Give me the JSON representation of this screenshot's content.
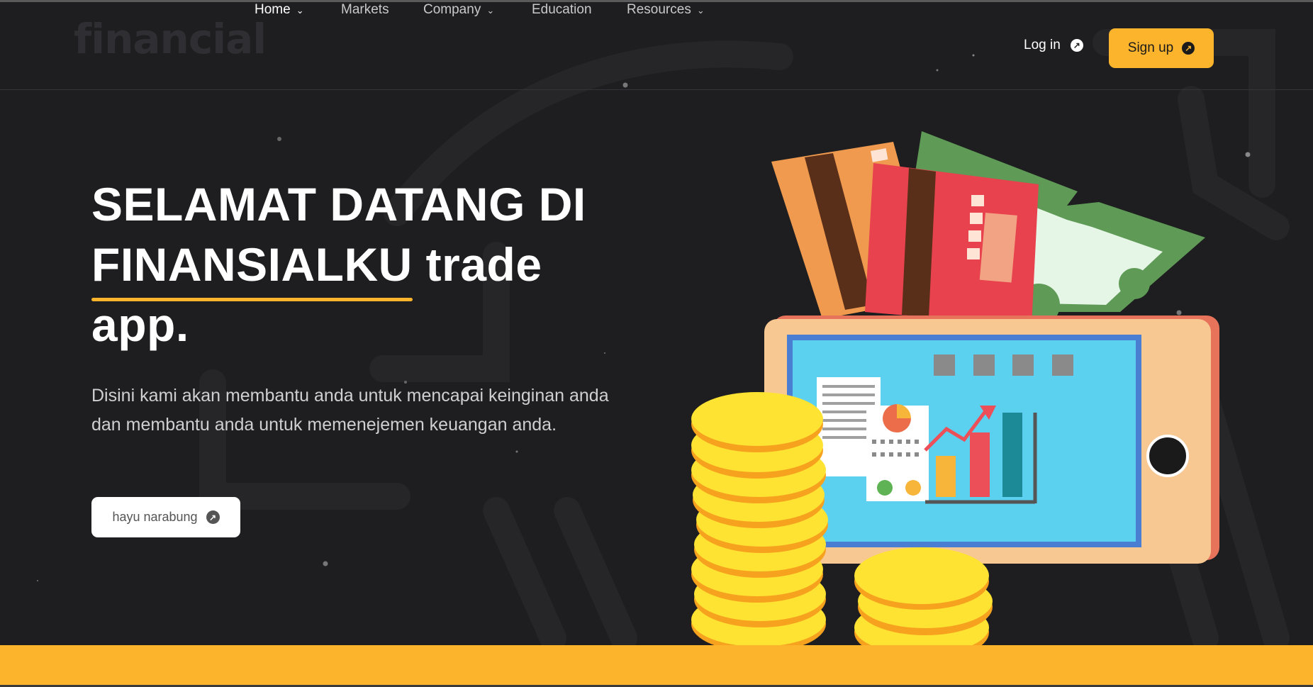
{
  "logo": "financial",
  "nav": {
    "items": [
      {
        "label": "Home",
        "dropdown": true,
        "active": true
      },
      {
        "label": "Markets",
        "dropdown": false,
        "active": false
      },
      {
        "label": "Company",
        "dropdown": true,
        "active": false
      },
      {
        "label": "Education",
        "dropdown": false,
        "active": false
      },
      {
        "label": "Resources",
        "dropdown": true,
        "active": false
      }
    ],
    "login_label": "Log in",
    "signup_label": "Sign up"
  },
  "hero": {
    "title_line1": "SELAMAT DATANG DI",
    "title_highlight": "FINANSIALKU",
    "title_after_highlight": " trade",
    "title_line3": "app.",
    "description": "Disini kami akan membantu anda untuk mencapai keinginan anda dan membantu anda untuk memenejemen keuangan anda.",
    "cta_label": "hayu narabung"
  },
  "colors": {
    "accent": "#fbb42b",
    "background": "#1e1e20"
  },
  "icons": {
    "chevron": "chevron-down-icon",
    "arrow": "arrow-up-right-circle-icon"
  }
}
